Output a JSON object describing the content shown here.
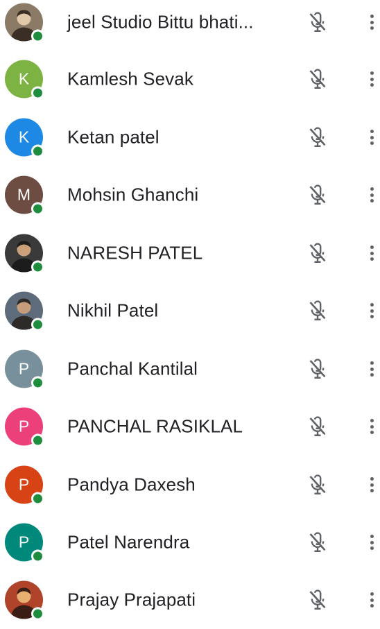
{
  "participants": [
    {
      "name": "jeel Studio Bittu bhati...",
      "avatar": {
        "type": "photo",
        "icon": "person-photo"
      },
      "online": true,
      "mic": "mic-off-icon"
    },
    {
      "name": "Kamlesh Sevak",
      "avatar": {
        "type": "letter",
        "letter": "K",
        "color": "#7cb342"
      },
      "online": true,
      "mic": "mic-off-icon"
    },
    {
      "name": "Ketan patel",
      "avatar": {
        "type": "letter",
        "letter": "K",
        "color": "#1e88e5"
      },
      "online": true,
      "mic": "mic-off-icon"
    },
    {
      "name": "Mohsin Ghanchi",
      "avatar": {
        "type": "letter",
        "letter": "M",
        "color": "#6d4c41"
      },
      "online": true,
      "mic": "mic-off-icon"
    },
    {
      "name": "NARESH PATEL",
      "avatar": {
        "type": "photo",
        "icon": "person-photo"
      },
      "online": true,
      "mic": "mic-off-icon"
    },
    {
      "name": "Nikhil Patel",
      "avatar": {
        "type": "photo",
        "icon": "person-photo"
      },
      "online": true,
      "mic": "mic-off-icon"
    },
    {
      "name": "Panchal Kantilal",
      "avatar": {
        "type": "letter",
        "letter": "P",
        "color": "#78909c"
      },
      "online": true,
      "mic": "mic-off-icon"
    },
    {
      "name": "PANCHAL RASIKLAL",
      "avatar": {
        "type": "letter",
        "letter": "P",
        "color": "#ec407a"
      },
      "online": true,
      "mic": "mic-off-icon"
    },
    {
      "name": "Pandya Daxesh",
      "avatar": {
        "type": "letter",
        "letter": "P",
        "color": "#d84315"
      },
      "online": true,
      "mic": "mic-off-icon"
    },
    {
      "name": "Patel Narendra",
      "avatar": {
        "type": "letter",
        "letter": "P",
        "color": "#00897b"
      },
      "online": true,
      "mic": "mic-off-icon"
    },
    {
      "name": "Prajay Prajapati",
      "avatar": {
        "type": "photo",
        "icon": "person-photo"
      },
      "online": true,
      "mic": "mic-off-icon"
    }
  ],
  "colors": {
    "online_dot": "#1e8e3e",
    "icon_gray": "#5f6368",
    "text": "#202124"
  }
}
